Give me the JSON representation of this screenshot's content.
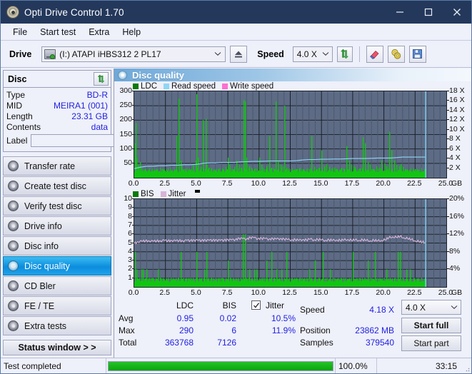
{
  "window": {
    "title": "Opti Drive Control 1.70",
    "icon": "disc-icon",
    "minimize": "minimize-icon",
    "maximize": "maximize-icon",
    "close": "close-icon"
  },
  "menu": [
    {
      "label": "File"
    },
    {
      "label": "Start test"
    },
    {
      "label": "Extra"
    },
    {
      "label": "Help"
    }
  ],
  "toolbar": {
    "drive_label": "Drive",
    "drive_value": "(I:)   ATAPI iHBS312  2 PL17",
    "eject_icon": "eject-icon",
    "speed_label": "Speed",
    "speed_value": "4.0 X",
    "refresh_icon": "refresh-icon",
    "erase_icon": "eraser-icon",
    "burn_icon": "burn-disc-icon",
    "save_icon": "save-floppy-icon"
  },
  "disc_panel": {
    "title": "Disc",
    "refresh_icon": "refresh-icon",
    "rows": [
      {
        "key": "Type",
        "value": "BD-R"
      },
      {
        "key": "MID",
        "value": "MEIRA1 (001)"
      },
      {
        "key": "Length",
        "value": "23.31 GB"
      },
      {
        "key": "Contents",
        "value": "data"
      }
    ],
    "label_key": "Label",
    "label_value": "",
    "label_placeholder": "",
    "label_button_icon": "cd-disc-icon"
  },
  "nav": [
    {
      "label": "Transfer rate",
      "icon": "disc-icon",
      "active": false
    },
    {
      "label": "Create test disc",
      "icon": "disc-icon",
      "active": false
    },
    {
      "label": "Verify test disc",
      "icon": "disc-icon",
      "active": false
    },
    {
      "label": "Drive info",
      "icon": "disc-icon",
      "active": false
    },
    {
      "label": "Disc info",
      "icon": "disc-icon",
      "active": false
    },
    {
      "label": "Disc quality",
      "icon": "disc-icon",
      "active": true
    },
    {
      "label": "CD Bler",
      "icon": "disc-icon",
      "active": false
    },
    {
      "label": "FE / TE",
      "icon": "disc-icon",
      "active": false
    },
    {
      "label": "Extra tests",
      "icon": "disc-icon",
      "active": false
    }
  ],
  "status_window_button": "Status window > >",
  "panel": {
    "header_title": "Disc quality",
    "header_icon": "disc-quality-icon"
  },
  "stats": {
    "col_ldc": "LDC",
    "col_bis": "BIS",
    "jitter_label": "Jitter",
    "jitter_checked": true,
    "row_avg": "Avg",
    "row_max": "Max",
    "row_total": "Total",
    "ldc_avg": "0.95",
    "ldc_max": "290",
    "ldc_total": "363768",
    "bis_avg": "0.02",
    "bis_max": "6",
    "bis_total": "7126",
    "jitter_avg": "10.5%",
    "jitter_max": "11.9%",
    "speed_label": "Speed",
    "speed_value": "4.18 X",
    "position_label": "Position",
    "position_value": "23862 MB",
    "samples_label": "Samples",
    "samples_value": "379540",
    "speed_select": "4.0 X",
    "start_full": "Start full",
    "start_part": "Start part"
  },
  "statusbar": {
    "text": "Test completed",
    "percent": "100.0%",
    "progress": 100,
    "time": "33:15"
  },
  "colors": {
    "title_bar": "#24385c",
    "plot_bg": "#5d6b85",
    "ldc_green": "#12c512",
    "read_speed_blue": "#8fd6f5",
    "write_speed_pink": "#ff6fd0",
    "jitter_pink": "#d8b4d8",
    "accent_blue": "#2222dd",
    "progress_green": "#0ea811"
  },
  "chart_data": [
    {
      "type": "line",
      "id": "ldc-chart",
      "title": "Disc quality - LDC",
      "legend": [
        {
          "label": "LDC",
          "color": "#0a7a0a"
        },
        {
          "label": "Read speed",
          "color": "#8fd6f5"
        },
        {
          "label": "Write speed",
          "color": "#ff6fd0"
        }
      ],
      "legend_position": "top-left",
      "grid": true,
      "xlabel": "GB",
      "xlim": [
        0,
        25
      ],
      "xticks": [
        "0.0",
        "2.5",
        "5.0",
        "7.5",
        "10.0",
        "12.5",
        "15.0",
        "17.5",
        "20.0",
        "22.5",
        "25.0"
      ],
      "ylabel_left": "LDC",
      "ylim": [
        0,
        300
      ],
      "yticks": [
        50,
        100,
        150,
        200,
        250,
        300
      ],
      "ylabel_right": "Speed",
      "ylim_right": [
        0,
        18
      ],
      "yticks_right": [
        "2 X",
        "4 X",
        "6 X",
        "8 X",
        "10 X",
        "12 X",
        "14 X",
        "16 X",
        "18 X"
      ],
      "series": [
        {
          "name": "LDC",
          "color": "#12c512",
          "style": "spikes",
          "x": [
            0.05,
            0.12,
            0.2,
            0.28,
            0.35,
            0.45,
            0.55,
            0.7,
            0.85,
            1.0,
            1.2,
            1.4,
            1.6,
            1.8,
            2.0,
            2.2,
            2.4,
            2.6,
            2.8,
            3.0,
            3.2,
            3.4,
            3.55,
            3.7,
            3.8,
            3.95,
            4.1,
            4.3,
            4.5,
            4.7,
            4.9,
            5.0,
            5.1,
            5.3,
            5.5,
            5.7,
            5.8,
            5.95,
            6.1,
            6.3,
            6.5,
            6.7,
            6.9,
            7.1,
            7.3,
            7.5,
            7.6,
            7.8,
            8.0,
            8.2,
            8.4,
            8.6,
            8.75,
            8.85,
            9.0,
            9.2,
            9.4,
            9.6,
            9.8,
            10.0,
            10.2,
            10.4,
            10.6,
            10.8,
            11.0,
            11.2,
            11.35,
            11.5,
            11.7,
            11.9,
            12.0,
            12.2,
            12.4,
            12.6,
            12.8,
            13.0,
            13.2,
            13.4,
            13.6,
            13.8,
            14.0,
            14.2,
            14.4,
            14.6,
            14.8,
            15.0,
            15.2,
            15.4,
            15.6,
            15.8,
            16.0,
            16.2,
            16.4,
            16.6,
            16.8,
            17.0,
            17.2,
            17.4,
            17.55,
            17.7,
            17.9,
            18.1,
            18.3,
            18.5,
            18.7,
            18.9,
            19.0,
            19.2,
            19.4,
            19.6,
            19.8,
            20.0,
            20.2,
            20.4,
            20.6,
            20.8,
            21.0,
            21.2,
            21.35,
            21.5,
            21.7,
            21.9,
            22.1,
            22.3,
            22.5,
            22.7,
            22.9,
            23.1,
            23.3,
            23.5
          ],
          "y": [
            120,
            190,
            70,
            45,
            40,
            55,
            30,
            25,
            28,
            22,
            20,
            26,
            24,
            20,
            22,
            30,
            18,
            22,
            26,
            20,
            25,
            145,
            275,
            60,
            45,
            30,
            25,
            28,
            30,
            45,
            60,
            290,
            70,
            38,
            200,
            205,
            45,
            35,
            30,
            28,
            26,
            30,
            24,
            30,
            38,
            70,
            45,
            30,
            38,
            60,
            45,
            35,
            270,
            265,
            70,
            40,
            35,
            30,
            28,
            70,
            45,
            30,
            40,
            145,
            35,
            30,
            265,
            60,
            45,
            40,
            250,
            35,
            30,
            25,
            28,
            30,
            32,
            28,
            26,
            24,
            30,
            145,
            38,
            30,
            35,
            95,
            40,
            48,
            38,
            32,
            36,
            30,
            28,
            34,
            30,
            110,
            60,
            45,
            40,
            36,
            30,
            32,
            140,
            120,
            55,
            45,
            30,
            28,
            40,
            35,
            60,
            50,
            40,
            160,
            95,
            60,
            45,
            40,
            48,
            38,
            30,
            26,
            24,
            28,
            30,
            20
          ]
        },
        {
          "name": "Read speed",
          "color": "#8fd6f5",
          "style": "line",
          "x": [
            0.0,
            0.5,
            1.0,
            1.5,
            2.0,
            2.5,
            3.0,
            3.5,
            4.0,
            4.5,
            5.0,
            5.5,
            6.0,
            6.5,
            7.0,
            7.5,
            8.0,
            8.5,
            9.0,
            9.5,
            10.0,
            10.5,
            11.0,
            11.5,
            12.0,
            12.5,
            13.0,
            13.5,
            14.0,
            14.5,
            15.0,
            15.5,
            16.0,
            16.5,
            17.0,
            17.5,
            18.0,
            18.5,
            19.0,
            19.5,
            20.0,
            20.5,
            21.0,
            21.5,
            22.0,
            22.5,
            23.0,
            23.3
          ],
          "y_speed": [
            1.9,
            2.2,
            2.4,
            2.4,
            2.5,
            2.5,
            2.6,
            2.6,
            2.7,
            2.7,
            2.8,
            3.0,
            3.1,
            3.1,
            3.2,
            3.2,
            3.2,
            3.3,
            3.35,
            3.4,
            3.4,
            3.45,
            3.5,
            3.5,
            3.5,
            3.5,
            3.55,
            3.7,
            3.8,
            3.8,
            3.85,
            3.85,
            3.9,
            3.9,
            3.95,
            4.0,
            4.0,
            4.0,
            4.05,
            4.1,
            4.1,
            4.1,
            4.2,
            4.3,
            4.3,
            4.3,
            4.3,
            4.3
          ]
        },
        {
          "name": "Write speed",
          "color": "#ff6fd0",
          "style": "line",
          "x": [],
          "y": []
        }
      ],
      "end_marker_x": 23.35
    },
    {
      "type": "line",
      "id": "bis-chart",
      "title": "Disc quality - BIS / Jitter",
      "legend": [
        {
          "label": "BIS",
          "color": "#0a7a0a"
        },
        {
          "label": "Jitter",
          "color": "#d8b4d8"
        }
      ],
      "legend_position": "top-left",
      "grid": true,
      "xlabel": "GB",
      "xlim": [
        0,
        25
      ],
      "xticks": [
        "0.0",
        "2.5",
        "5.0",
        "7.5",
        "10.0",
        "12.5",
        "15.0",
        "17.5",
        "20.0",
        "22.5",
        "25.0"
      ],
      "ylabel_left": "BIS",
      "ylim": [
        0,
        10
      ],
      "yticks": [
        1,
        2,
        3,
        4,
        5,
        6,
        7,
        8,
        9,
        10
      ],
      "ylabel_right": "Jitter",
      "ylim_right": [
        0,
        20
      ],
      "yticks_right": [
        "4%",
        "8%",
        "12%",
        "16%",
        "20%"
      ],
      "series": [
        {
          "name": "BIS",
          "color": "#12c512",
          "style": "spikes",
          "x": [
            0.05,
            0.15,
            0.25,
            0.4,
            0.55,
            0.7,
            0.85,
            1.0,
            1.15,
            1.3,
            1.5,
            1.7,
            1.9,
            2.1,
            2.3,
            2.5,
            2.7,
            2.9,
            3.1,
            3.3,
            3.5,
            3.7,
            3.9,
            4.1,
            4.3,
            4.5,
            4.7,
            4.9,
            5.0,
            5.2,
            5.4,
            5.6,
            5.8,
            5.9,
            6.1,
            6.3,
            6.5,
            6.7,
            6.9,
            7.1,
            7.3,
            7.5,
            7.7,
            7.9,
            8.1,
            8.3,
            8.5,
            8.7,
            8.85,
            9.0,
            9.2,
            9.4,
            9.6,
            9.8,
            10.0,
            10.2,
            10.4,
            10.6,
            10.8,
            11.0,
            11.2,
            11.4,
            11.6,
            11.8,
            12.0,
            12.2,
            12.4,
            12.6,
            12.8,
            13.0,
            13.2,
            13.4,
            13.6,
            13.8,
            14.0,
            14.2,
            14.5,
            14.8,
            15.1,
            15.4,
            15.7,
            16.0,
            16.3,
            16.6,
            16.9,
            17.2,
            17.5,
            17.8,
            18.1,
            18.4,
            18.7,
            19.0,
            19.3,
            19.6,
            19.9,
            20.2,
            20.5,
            20.8,
            21.1,
            21.3,
            21.5,
            21.8,
            22.1,
            22.4,
            22.7,
            23.0,
            23.3
          ],
          "y": [
            4,
            2,
            1,
            1,
            2,
            2,
            1,
            2,
            1,
            1,
            1,
            1,
            2,
            1,
            1,
            1,
            1,
            1,
            1,
            1,
            1,
            4,
            1,
            1,
            1,
            1,
            1,
            1,
            4,
            1,
            1,
            2,
            4,
            1,
            1,
            1,
            1,
            1,
            1,
            1,
            1,
            3,
            1,
            1,
            1,
            1,
            1,
            6,
            6,
            1,
            2,
            1,
            2,
            2,
            1,
            1,
            1,
            3,
            1,
            4,
            1,
            2,
            1,
            2,
            1,
            4,
            1,
            1,
            1,
            1,
            1,
            1,
            1,
            1,
            2,
            1,
            3,
            1,
            4,
            1,
            2,
            1,
            1,
            1,
            1,
            1,
            4,
            1,
            1,
            1,
            3,
            1,
            4,
            1,
            1,
            2,
            1,
            1,
            4,
            4,
            1,
            2,
            2,
            1,
            1,
            1,
            1
          ]
        },
        {
          "name": "Jitter",
          "color": "#d8b4d8",
          "style": "line",
          "x": [
            0.0,
            0.3,
            0.6,
            0.9,
            1.2,
            1.5,
            1.8,
            2.1,
            2.4,
            2.7,
            3.0,
            3.3,
            3.6,
            3.9,
            4.2,
            4.5,
            4.8,
            5.1,
            5.4,
            5.7,
            6.0,
            6.3,
            6.6,
            6.9,
            7.2,
            7.5,
            7.8,
            8.1,
            8.4,
            8.7,
            9.0,
            9.3,
            9.6,
            9.9,
            10.2,
            10.5,
            10.8,
            11.1,
            11.4,
            11.7,
            12.0,
            12.3,
            12.6,
            12.9,
            13.2,
            13.5,
            13.8,
            14.1,
            14.4,
            14.7,
            15.0,
            15.3,
            15.6,
            15.9,
            16.2,
            16.5,
            16.8,
            17.1,
            17.4,
            17.7,
            18.0,
            18.3,
            18.6,
            18.9,
            19.2,
            19.5,
            19.8,
            20.1,
            20.4,
            20.7,
            21.0,
            21.3,
            21.6,
            21.9,
            22.2,
            22.5,
            22.8,
            23.1,
            23.3
          ],
          "y_pct": [
            9.9,
            10.3,
            10.4,
            10.5,
            10.5,
            10.4,
            10.5,
            10.5,
            10.6,
            10.5,
            10.6,
            10.5,
            10.6,
            10.5,
            10.6,
            10.6,
            10.7,
            10.6,
            10.6,
            10.7,
            10.6,
            10.7,
            10.7,
            10.6,
            10.7,
            10.8,
            10.7,
            10.8,
            11.1,
            11.0,
            10.9,
            11.3,
            11.2,
            11.0,
            11.1,
            11.0,
            10.9,
            11.0,
            10.9,
            11.0,
            10.9,
            10.8,
            10.7,
            10.8,
            10.6,
            10.8,
            10.7,
            10.9,
            10.7,
            10.8,
            10.7,
            10.6,
            10.7,
            10.6,
            10.7,
            10.6,
            10.7,
            10.8,
            10.6,
            10.7,
            10.6,
            10.7,
            10.6,
            10.5,
            10.6,
            10.5,
            10.6,
            10.7,
            11.2,
            11.4,
            11.3,
            11.5,
            11.2,
            11.0,
            10.8,
            10.5,
            10.3,
            10.2,
            10.1
          ]
        }
      ],
      "end_marker_x": 23.35
    }
  ]
}
